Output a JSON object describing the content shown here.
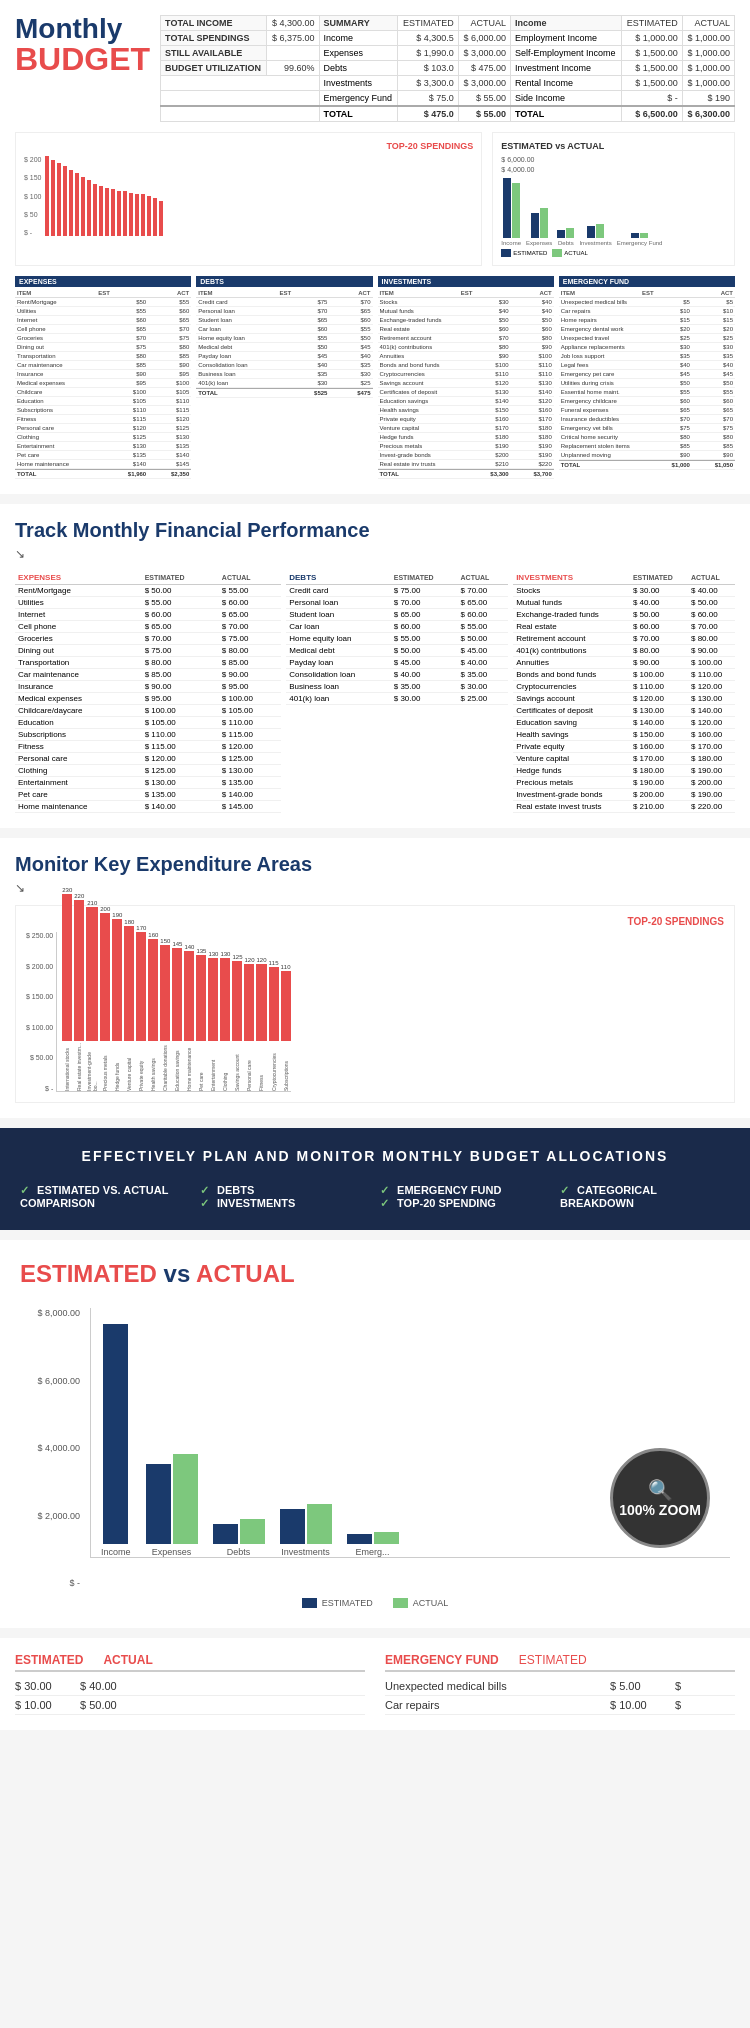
{
  "logo": {
    "monthly": "Monthly",
    "budget": "BUDGET"
  },
  "summary": {
    "total_income_label": "TOTAL INCOME",
    "total_income_value": "$ 4,300.00",
    "total_spendings_label": "TOTAL SPENDINGS",
    "total_spendings_value": "$ 6,375.00",
    "still_available_label": "STILL AVAILABLE",
    "still_available_value": "",
    "budget_utilization_label": "BUDGET UTILIZATION",
    "budget_utilization_value": "99.60%",
    "summary_label": "SUMMARY",
    "estimated_label": "ESTIMATED",
    "actual_label": "ACTUAL",
    "income_row": [
      "Income",
      "$ 4,300.5",
      "$ 6,000.00"
    ],
    "expenses_row": [
      "Expenses",
      "$ 1,990.0",
      "$ 3,000.00"
    ],
    "debts_row": [
      "Debts",
      "$ 103.0",
      "$ 475.00"
    ],
    "investments_row": [
      "Investments",
      "$ 3,300.0",
      "$ 3,000.00"
    ],
    "emergency_row": [
      "Emergency Fund",
      "$ 75.0",
      "$ 55.00"
    ],
    "total_row": [
      "TOTAL",
      "$ 475.0",
      "$ 55.00"
    ]
  },
  "top20_chart_title": "TOP-20 SPENDINGS",
  "estimated_vs_actual_title": "ESTIMATED vs ACTUAL",
  "expenses_section": {
    "header": "EXPENSES",
    "col1": "ESTIMATED",
    "col2": "ACTUAL",
    "items": [
      {
        "name": "Rent/Mortgage",
        "est": "$ 50.00",
        "act": "$ 55.00"
      },
      {
        "name": "Utilities",
        "est": "$ 55.00",
        "act": "$ 60.00"
      },
      {
        "name": "Internet",
        "est": "$ 60.00",
        "act": "$ 65.00"
      },
      {
        "name": "Cell phone",
        "est": "$ 65.00",
        "act": "$ 70.00"
      },
      {
        "name": "Groceries",
        "est": "$ 70.00",
        "act": "$ 75.00"
      },
      {
        "name": "Dining out",
        "est": "$ 75.00",
        "act": "$ 80.00"
      },
      {
        "name": "Transportation",
        "est": "$ 80.00",
        "act": "$ 85.00"
      },
      {
        "name": "Car maintenance",
        "est": "$ 85.00",
        "act": "$ 90.00"
      },
      {
        "name": "Insurance",
        "est": "$ 90.00",
        "act": "$ 95.00"
      },
      {
        "name": "Medical expenses",
        "est": "$ 95.00",
        "act": "$ 100.00"
      },
      {
        "name": "Childcare/daycare",
        "est": "$ 100.00",
        "act": "$ 105.00"
      },
      {
        "name": "Education",
        "est": "$ 105.00",
        "act": "$ 110.00"
      },
      {
        "name": "Subscriptions",
        "est": "$ 110.00",
        "act": "$ 115.00"
      },
      {
        "name": "Fitness",
        "est": "$ 115.00",
        "act": "$ 120.00"
      },
      {
        "name": "Personal care",
        "est": "$ 120.00",
        "act": "$ 125.00"
      },
      {
        "name": "Clothing",
        "est": "$ 125.00",
        "act": "$ 130.00"
      },
      {
        "name": "Entertainment",
        "est": "$ 130.00",
        "act": "$ 135.00"
      },
      {
        "name": "Pet care",
        "est": "$ 135.00",
        "act": "$ 140.00"
      },
      {
        "name": "Home maintenance",
        "est": "$ 140.00",
        "act": "$ 145.00"
      }
    ],
    "total": {
      "name": "TOTAL",
      "est": "$ 1,960.00",
      "act": "$ 2,350.00"
    }
  },
  "debts_section": {
    "header": "DEBTS",
    "col1": "ESTIMATED",
    "col2": "ACTUAL",
    "items": [
      {
        "name": "Credit card",
        "est": "$ 75.00",
        "act": "$ 70.00"
      },
      {
        "name": "Personal loan",
        "est": "$ 70.00",
        "act": "$ 65.00"
      },
      {
        "name": "Student loan",
        "est": "$ 65.00",
        "act": "$ 60.00"
      },
      {
        "name": "Car loan",
        "est": "$ 60.00",
        "act": "$ 55.00"
      },
      {
        "name": "Home equity loan",
        "est": "$ 55.00",
        "act": "$ 50.00"
      },
      {
        "name": "Medical debt",
        "est": "$ 50.00",
        "act": "$ 45.00"
      },
      {
        "name": "Payday loan",
        "est": "$ 45.00",
        "act": "$ 40.00"
      },
      {
        "name": "Consolidation loan",
        "est": "$ 40.00",
        "act": "$ 35.00"
      },
      {
        "name": "Business loan",
        "est": "$ 35.00",
        "act": "$ 30.00"
      },
      {
        "name": "401(k) loan",
        "est": "$ 30.00",
        "act": "$ 25.00"
      }
    ],
    "total": {
      "name": "TOTAL",
      "est": "$ 525.00",
      "act": "$ 475.00"
    }
  },
  "investments_section": {
    "header": "INVESTMENTS",
    "col1": "ESTIMATED",
    "col2": "ACTUAL",
    "items": [
      {
        "name": "Stocks",
        "est": "$ 30.00",
        "act": "$ 40.00"
      },
      {
        "name": "Mutual funds",
        "est": "$ 40.00",
        "act": "$ 40.00"
      },
      {
        "name": "Exchange-traded funds",
        "est": "$ 50.00",
        "act": "$ 50.00"
      },
      {
        "name": "Real estate",
        "est": "$ 60.00",
        "act": "$ 60.00"
      },
      {
        "name": "Retirement account",
        "est": "$ 70.00",
        "act": "$ 80.00"
      },
      {
        "name": "401(k) contributions",
        "est": "$ 80.00",
        "act": "$ 90.00"
      },
      {
        "name": "Annuities",
        "est": "$ 90.00",
        "act": "$ 100.00"
      },
      {
        "name": "Bonds and bond funds",
        "est": "$ 100.00",
        "act": "$ 110.00"
      },
      {
        "name": "Cryptocurrencies",
        "est": "$ 110.00",
        "act": "$ 110.00"
      },
      {
        "name": "Savings account",
        "est": "$ 120.00",
        "act": "$ 130.00"
      },
      {
        "name": "Certificates of deposit",
        "est": "$ 130.00",
        "act": "$ 140.00"
      },
      {
        "name": "Education savings",
        "est": "$ 140.00",
        "act": "$ 120.00"
      },
      {
        "name": "Health savings",
        "est": "$ 150.00",
        "act": "$ 160.00"
      },
      {
        "name": "Private equity",
        "est": "$ 160.00",
        "act": "$ 170.00"
      },
      {
        "name": "Venture capital",
        "est": "$ 170.00",
        "act": "$ 180.00"
      },
      {
        "name": "Hedge funds",
        "est": "$ 180.00",
        "act": "$ 180.00"
      },
      {
        "name": "Precious metals",
        "est": "$ 190.00",
        "act": "$ 190.00"
      },
      {
        "name": "Investment-grade bonds",
        "est": "$ 200.00",
        "act": "$ 190.00"
      },
      {
        "name": "Real estate investment trusts",
        "est": "$ 210.00",
        "act": "$ 220.00"
      }
    ],
    "total": {
      "name": "TOTAL",
      "est": "$ 3,300.00",
      "act": "$ 3,700.00"
    }
  },
  "emergency_fund_section": {
    "header": "EMERGENCY FUND",
    "col1": "ACTUAL",
    "items": [
      {
        "name": "Unexpected medical bills",
        "est": "$ 5.00",
        "act": "$ 5.00"
      },
      {
        "name": "Car repairs",
        "est": "$ 10.00",
        "act": "$ 10.00"
      },
      {
        "name": "Home repairs",
        "est": "$ 15.00",
        "act": "$ 15.00"
      },
      {
        "name": "Emergency dental work",
        "est": "$ 20.00",
        "act": "$ 20.00"
      },
      {
        "name": "Unexpected travel expenses",
        "est": "$ 25.00",
        "act": "$ 25.00"
      },
      {
        "name": "Appliance replacements",
        "est": "$ 30.00",
        "act": "$ 30.00"
      },
      {
        "name": "Job loss support",
        "est": "$ 35.00",
        "act": "$ 35.00"
      },
      {
        "name": "Legal fees",
        "est": "$ 40.00",
        "act": "$ 40.00"
      },
      {
        "name": "Emergency pet care",
        "est": "$ 45.00",
        "act": "$ 45.00"
      },
      {
        "name": "Utilities during a crisis",
        "est": "$ 50.00",
        "act": "$ 50.00"
      },
      {
        "name": "Essential home maintenance",
        "est": "$ 55.00",
        "act": "$ 55.00"
      },
      {
        "name": "Emergency childcare",
        "est": "$ 60.00",
        "act": "$ 60.00"
      },
      {
        "name": "Funeral expenses",
        "est": "$ 65.00",
        "act": "$ 65.00"
      },
      {
        "name": "Insurance deductibles",
        "est": "$ 70.00",
        "act": "$ 70.00"
      },
      {
        "name": "Emergency vet bills",
        "est": "$ 75.00",
        "act": "$ 75.00"
      },
      {
        "name": "Critical home security repairs",
        "est": "$ 80.00",
        "act": "$ 80.00"
      },
      {
        "name": "Replacement of stolen items",
        "est": "$ 85.00",
        "act": "$ 85.00"
      },
      {
        "name": "Unplanned moving expenses",
        "est": "$ 90.00",
        "act": "$ 90.00"
      }
    ],
    "total": {
      "name": "TOTAL",
      "est": "1,000.00",
      "act": "1,050.00"
    }
  },
  "track_section": {
    "heading": "Track Monthly Financial Performance",
    "arrow": "↘"
  },
  "monitor_section": {
    "heading": "Monitor Key Expenditure Areas",
    "arrow": "↘"
  },
  "top20_bars": [
    {
      "label": "International stocks",
      "value": 230
    },
    {
      "label": "Real estate investm...",
      "value": 220
    },
    {
      "label": "Investment-grade bo...",
      "value": 210
    },
    {
      "label": "Precious metals",
      "value": 200
    },
    {
      "label": "Hedge funds",
      "value": 190
    },
    {
      "label": "Venture capital",
      "value": 180
    },
    {
      "label": "Private equity",
      "value": 170
    },
    {
      "label": "Health savings",
      "value": 160
    },
    {
      "label": "Charitable donations",
      "value": 150
    },
    {
      "label": "Education savings",
      "value": 145
    },
    {
      "label": "Home maintenance",
      "value": 140
    },
    {
      "label": "Pet care",
      "value": 135
    },
    {
      "label": "Entertainment",
      "value": 130
    },
    {
      "label": "Clothing",
      "value": 130
    },
    {
      "label": "Savings account",
      "value": 125
    },
    {
      "label": "Personal care",
      "value": 120
    },
    {
      "label": "Fitness",
      "value": 120
    },
    {
      "label": "Cryptocurrencies",
      "value": 115
    },
    {
      "label": "Subscriptions",
      "value": 110
    }
  ],
  "top20_y_labels": [
    "$ 250.00",
    "$ 200.00",
    "$ 150.00",
    "$ 100.00",
    "$ 50.00",
    "$ -"
  ],
  "banner": {
    "title": "EFFECTIVELY PLAN AND MONITOR MONTHLY BUDGET ALLOCATIONS",
    "features": [
      {
        "check": "✓",
        "text": "ESTIMATED VS. ACTUAL COMPARISON"
      },
      {
        "check": "✓",
        "text": "DEBTS"
      },
      {
        "check2": "✓",
        "text2": "INVESTMENTS"
      },
      {
        "check3": "✓",
        "text3": "EMERGENCY FUND"
      },
      {
        "check4": "✓",
        "text4": "TOP-20 SPENDING"
      },
      {
        "check5": "✓",
        "text5": "CATEGORICAL BREAKDOWN"
      }
    ]
  },
  "eva_large": {
    "title_estimated": "ESTIMATED",
    "title_vs": " vs ",
    "title_actual": "ACTUAL",
    "y_labels": [
      "$ 8,000.00",
      "",
      "$ 6,000.00",
      "",
      "$ 4,000.00",
      "",
      "$ 2,000.00",
      "",
      "$ -"
    ],
    "groups": [
      {
        "label": "Income",
        "est_height": 220,
        "act_height": 0
      },
      {
        "label": "Expenses",
        "est_height": 80,
        "act_height": 90
      },
      {
        "label": "Debts",
        "est_height": 20,
        "act_height": 25
      },
      {
        "label": "Investments",
        "est_height": 35,
        "act_height": 40
      },
      {
        "label": "Emerg...",
        "est_height": 10,
        "act_height": 12
      }
    ],
    "legend_estimated": "ESTIMATED",
    "legend_actual": "ACTUAL",
    "zoom_text": "100% ZOOM"
  },
  "bottom_section": {
    "left_header_estimated": "ESTIMATED",
    "left_header_actual": "ACTUAL",
    "right_header_fund": "EMERGENCY FUND",
    "right_header_estimated": "ESTIMATED",
    "left_rows": [
      {
        "est": "$ 30.00",
        "act": "$ 40.00"
      },
      {
        "est": "$ 10.00",
        "act": "$ 50.00"
      }
    ],
    "right_rows": [
      {
        "item": "Unexpected medical bills",
        "val": "$ 5.00"
      },
      {
        "item": "Car repairs",
        "val": "$ 10.00"
      }
    ]
  }
}
